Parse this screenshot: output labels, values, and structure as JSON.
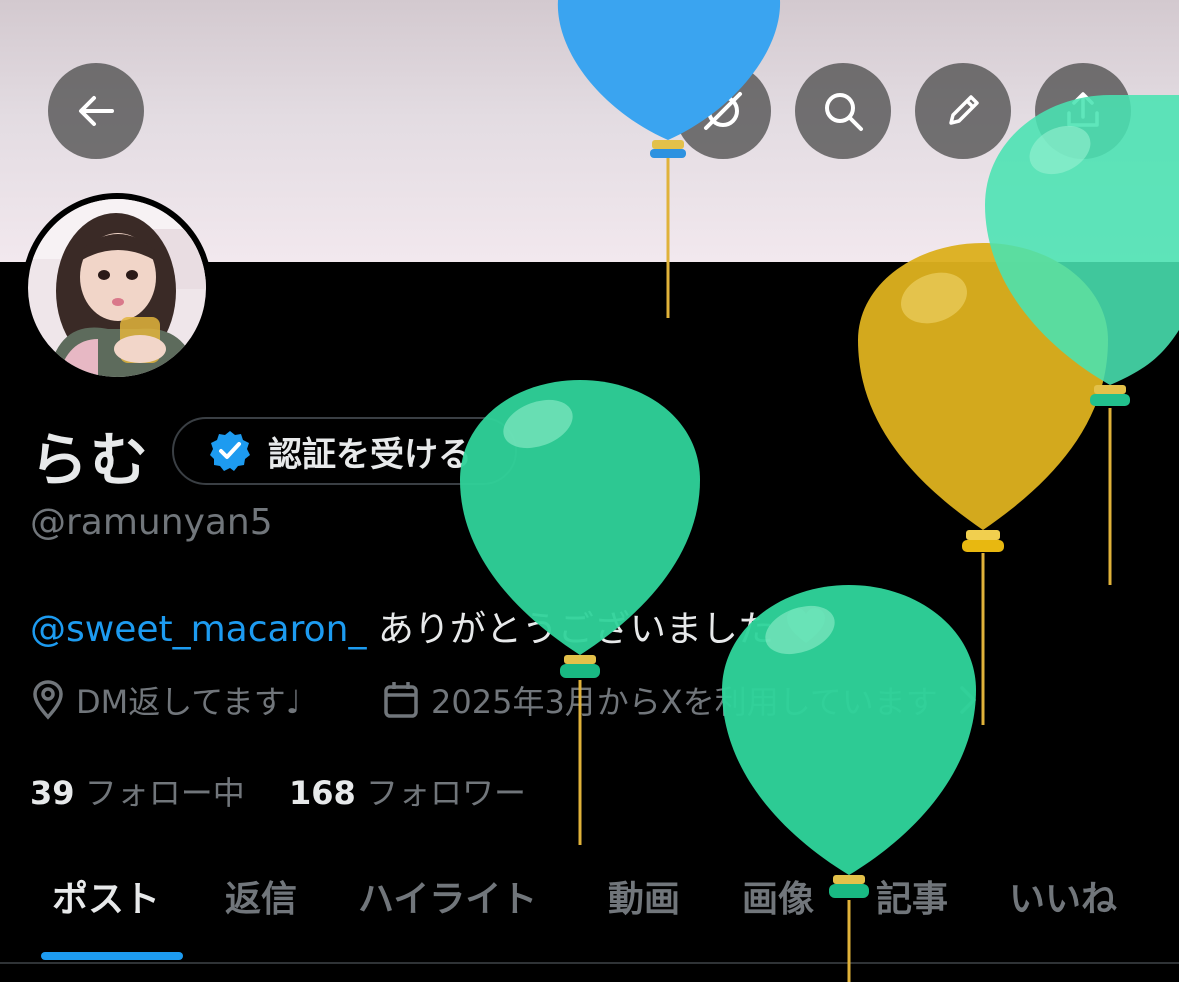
{
  "header": {
    "back_icon": "arrow-left-icon",
    "actions": [
      "grok-icon",
      "search-icon",
      "edit-icon",
      "share-icon"
    ]
  },
  "profile": {
    "name": "らむ",
    "verify_label": "認証を受ける",
    "handle": "@ramunyan5",
    "bio_mention": "@sweet_macaron_",
    "bio_text": "ありがとうございました",
    "location": "DM返してます♩",
    "joined": "2025年3月からXを利用しています",
    "following_count": "39",
    "following_label": "フォロー中",
    "followers_count": "168",
    "followers_label": "フォロワー"
  },
  "tabs": [
    "ポスト",
    "返信",
    "ハイライト",
    "動画",
    "画像",
    "記事",
    "いいね"
  ],
  "colors": {
    "accent": "#1d9bf0",
    "muted": "#71767b",
    "text": "#e7e9ea",
    "balloon_green": "#2fd39a",
    "balloon_yellow": "#e3b21a",
    "balloon_blue": "#3aa4f0"
  }
}
